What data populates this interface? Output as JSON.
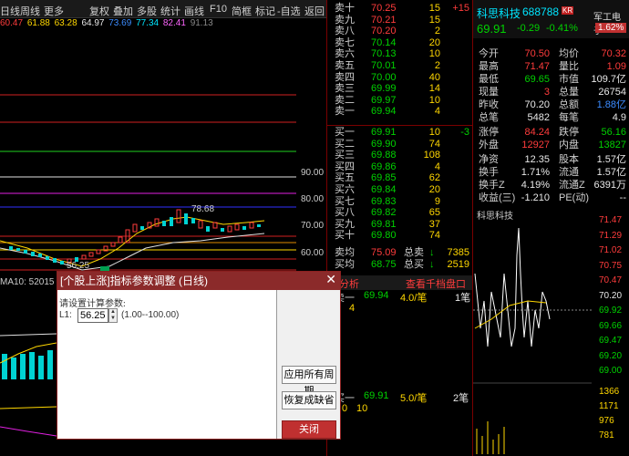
{
  "toolbar": {
    "items": [
      "日线",
      "周线",
      "更多",
      "复权",
      "叠加",
      "多股",
      "统计",
      "画线",
      "F10",
      "简框",
      "标记",
      "-自选",
      "返回"
    ]
  },
  "ma_line": {
    "values": [
      "60.47",
      "61.88",
      "63.28",
      "64.97",
      "73.69",
      "77.34",
      "82.41",
      "91.13"
    ]
  },
  "chart": {
    "axis_labels": [
      "90.00",
      "80.00",
      "70.00",
      "60.00"
    ],
    "high_label": "78.68",
    "low_label": "56.25",
    "ma10_label": "MA10: 52015"
  },
  "orderbook": {
    "sells": [
      {
        "label": "卖十",
        "price": "70.25",
        "vol": "15",
        "chg": "+15"
      },
      {
        "label": "卖九",
        "price": "70.21",
        "vol": "15",
        "chg": ""
      },
      {
        "label": "卖八",
        "price": "70.20",
        "vol": "2",
        "chg": ""
      },
      {
        "label": "卖七",
        "price": "70.14",
        "vol": "20",
        "chg": ""
      },
      {
        "label": "卖六",
        "price": "70.13",
        "vol": "10",
        "chg": ""
      },
      {
        "label": "卖五",
        "price": "70.01",
        "vol": "2",
        "chg": ""
      },
      {
        "label": "卖四",
        "price": "70.00",
        "vol": "40",
        "chg": ""
      },
      {
        "label": "卖三",
        "price": "69.99",
        "vol": "14",
        "chg": ""
      },
      {
        "label": "卖二",
        "price": "69.97",
        "vol": "10",
        "chg": ""
      },
      {
        "label": "卖一",
        "price": "69.94",
        "vol": "4",
        "chg": ""
      }
    ],
    "buys": [
      {
        "label": "买一",
        "price": "69.91",
        "vol": "10",
        "chg": "-3"
      },
      {
        "label": "买二",
        "price": "69.90",
        "vol": "74",
        "chg": ""
      },
      {
        "label": "买三",
        "price": "69.88",
        "vol": "108",
        "chg": ""
      },
      {
        "label": "买四",
        "price": "69.86",
        "vol": "4",
        "chg": ""
      },
      {
        "label": "买五",
        "price": "69.85",
        "vol": "62",
        "chg": ""
      },
      {
        "label": "买六",
        "price": "69.84",
        "vol": "20",
        "chg": ""
      },
      {
        "label": "买七",
        "price": "69.83",
        "vol": "9",
        "chg": ""
      },
      {
        "label": "买八",
        "price": "69.82",
        "vol": "65",
        "chg": ""
      },
      {
        "label": "买九",
        "price": "69.81",
        "vol": "37",
        "chg": ""
      },
      {
        "label": "买十",
        "price": "69.80",
        "vol": "74",
        "chg": ""
      }
    ],
    "avg_sell": {
      "label": "卖均",
      "price": "75.09",
      "total_label": "总卖",
      "total": "7385"
    },
    "avg_buy": {
      "label": "买均",
      "price": "68.75",
      "total_label": "总买",
      "total": "2519"
    },
    "tabs": [
      "笔分析",
      "查看千档盘口"
    ],
    "trade1": {
      "label": "卖一",
      "price": "69.94",
      "detail": "4.0/笔",
      "count": "1笔",
      "extra": "4"
    },
    "trade2": {
      "label": "买一",
      "price": "69.91",
      "detail": "5.0/笔",
      "count": "2笔",
      "extra1": "10",
      "extra2": "0"
    }
  },
  "stock": {
    "name": "科思科技",
    "code": "688788",
    "badge": "KR",
    "sector": "军工电子",
    "price": "69.91",
    "change": "-0.29",
    "change_pct": "-0.41%",
    "sector_pct": "1.62%",
    "stats": [
      {
        "k1": "今开",
        "v1": "70.50",
        "k2": "均价",
        "v2": "70.32"
      },
      {
        "k1": "最高",
        "v1": "71.47",
        "k2": "量比",
        "v2": "1.09"
      },
      {
        "k1": "最低",
        "v1": "69.65",
        "k2": "市值",
        "v2": "109.7亿"
      },
      {
        "k1": "现量",
        "v1": "3",
        "k2": "总量",
        "v2": "26754"
      },
      {
        "k1": "昨收",
        "v1": "70.20",
        "k2": "总额",
        "v2": "1.88亿"
      },
      {
        "k1": "总笔",
        "v1": "5482",
        "k2": "每笔",
        "v2": "4.9"
      },
      {
        "k1": "涨停",
        "v1": "84.24",
        "k2": "跌停",
        "v2": "56.16"
      },
      {
        "k1": "外盘",
        "v1": "12927",
        "k2": "内盘",
        "v2": "13827"
      },
      {
        "k1": "净资",
        "v1": "12.35",
        "k2": "股本",
        "v2": "1.57亿"
      },
      {
        "k1": "换手",
        "v1": "1.71%",
        "k2": "流通",
        "v2": "1.57亿"
      },
      {
        "k1": "换手Z",
        "v1": "4.19%",
        "k2": "流通Z",
        "v2": "6391万"
      },
      {
        "k1": "收益(三)",
        "v1": "-1.210",
        "k2": "PE(动)",
        "v2": "--"
      }
    ],
    "mini_title": "科思科技",
    "mini_axis": [
      "71.47",
      "71.29",
      "71.02",
      "70.75",
      "70.47",
      "70.20",
      "69.92",
      "69.66",
      "69.47",
      "69.20",
      "69.00",
      "1366",
      "1171",
      "976",
      "781"
    ]
  },
  "dialog": {
    "title": "[个股上涨]指标参数调整 (日线)",
    "prompt": "请设置计算参数:",
    "param_label": "L1:",
    "param_value": "56.25",
    "range": "(1.00--100.00)",
    "btn_apply": "应用所有周期",
    "btn_reset": "恢复成缺省",
    "btn_close": "关闭"
  },
  "colors": {
    "up": "#ff3c3c",
    "down": "#00d200",
    "accent": "#8b2a2a"
  }
}
